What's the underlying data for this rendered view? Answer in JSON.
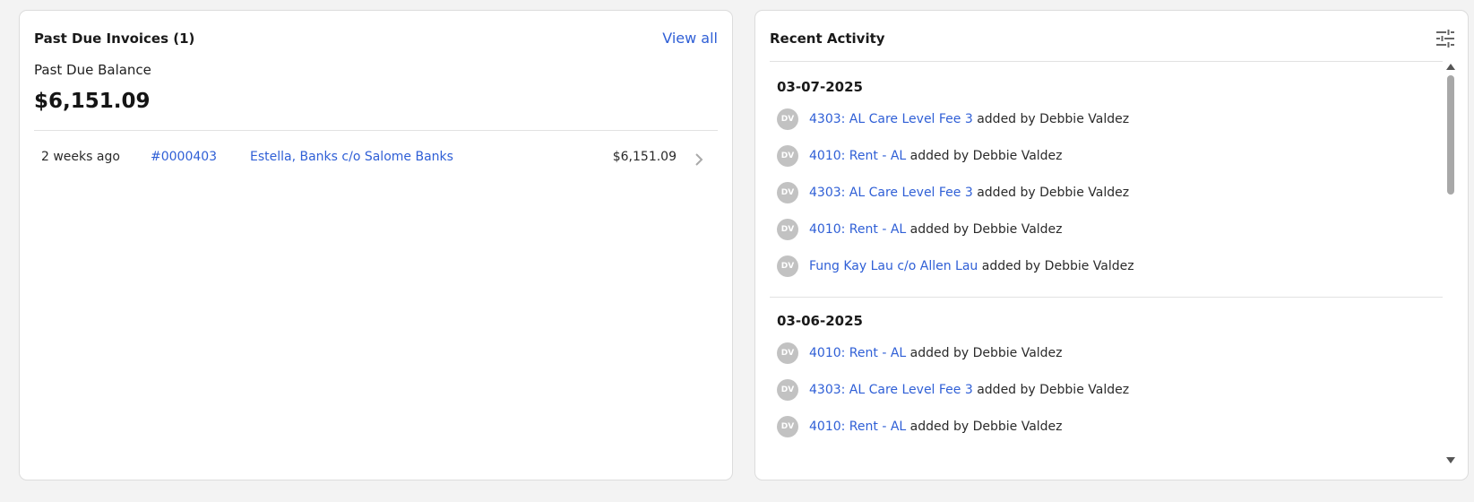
{
  "past_due": {
    "title": "Past Due Invoices (1)",
    "view_all_label": "View all",
    "balance_label": "Past Due Balance",
    "balance_value": "$6,151.09",
    "invoices": [
      {
        "age": "2 weeks ago",
        "number": "#0000403",
        "name": "Estella, Banks c/o Salome Banks",
        "amount": "$6,151.09"
      }
    ]
  },
  "activity": {
    "title": "Recent Activity",
    "filter_icon": "sliders-icon",
    "groups": [
      {
        "date": "03-07-2025",
        "items": [
          {
            "initials": "DV",
            "link": "4303: AL Care Level Fee 3",
            "text": " added by Debbie Valdez"
          },
          {
            "initials": "DV",
            "link": "4010: Rent - AL",
            "text": " added by Debbie Valdez"
          },
          {
            "initials": "DV",
            "link": "4303: AL Care Level Fee 3",
            "text": " added by Debbie Valdez"
          },
          {
            "initials": "DV",
            "link": "4010: Rent - AL",
            "text": " added by Debbie Valdez"
          },
          {
            "initials": "DV",
            "link": "Fung Kay Lau c/o Allen Lau",
            "text": " added by Debbie Valdez"
          }
        ]
      },
      {
        "date": "03-06-2025",
        "items": [
          {
            "initials": "DV",
            "link": "4010: Rent - AL",
            "text": " added by Debbie Valdez"
          },
          {
            "initials": "DV",
            "link": "4303: AL Care Level Fee 3",
            "text": " added by Debbie Valdez"
          },
          {
            "initials": "DV",
            "link": "4010: Rent - AL",
            "text": " added by Debbie Valdez"
          }
        ]
      }
    ]
  },
  "colors": {
    "link": "#2f5fd6",
    "avatar_bg": "#c2c2c2",
    "page_bg": "#f3f3f3"
  }
}
